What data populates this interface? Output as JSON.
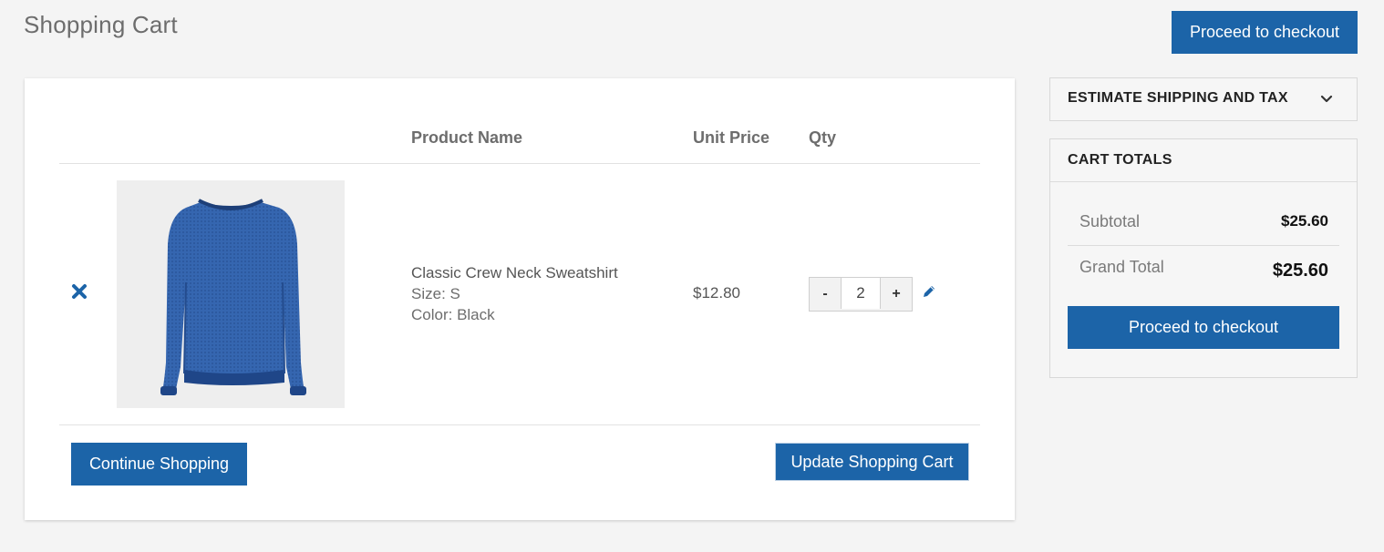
{
  "page": {
    "title": "Shopping Cart",
    "checkout_label": "Proceed to checkout"
  },
  "cart": {
    "columns": {
      "product_name": "Product Name",
      "unit_price": "Unit Price",
      "qty": "Qty"
    },
    "items": [
      {
        "name": "Classic Crew Neck Sweatshirt",
        "size": "Size: S",
        "color": "Color: Black",
        "unit_price": "$12.80",
        "qty": "2",
        "image_icon": "sweatshirt-image",
        "product_color": "#2f5fa8"
      }
    ],
    "qty_minus": "-",
    "qty_plus": "+",
    "continue_label": "Continue Shopping",
    "update_label": "Update Shopping Cart"
  },
  "sidebar": {
    "estimate_title": "ESTIMATE SHIPPING AND TAX",
    "totals_title": "CART TOTALS",
    "subtotal_label": "Subtotal",
    "subtotal_value": "$25.60",
    "grand_total_label": "Grand Total",
    "grand_total_value": "$25.60",
    "checkout_label": "Proceed to checkout"
  },
  "colors": {
    "accent": "#1c64a8",
    "background": "#f4f4f4"
  }
}
